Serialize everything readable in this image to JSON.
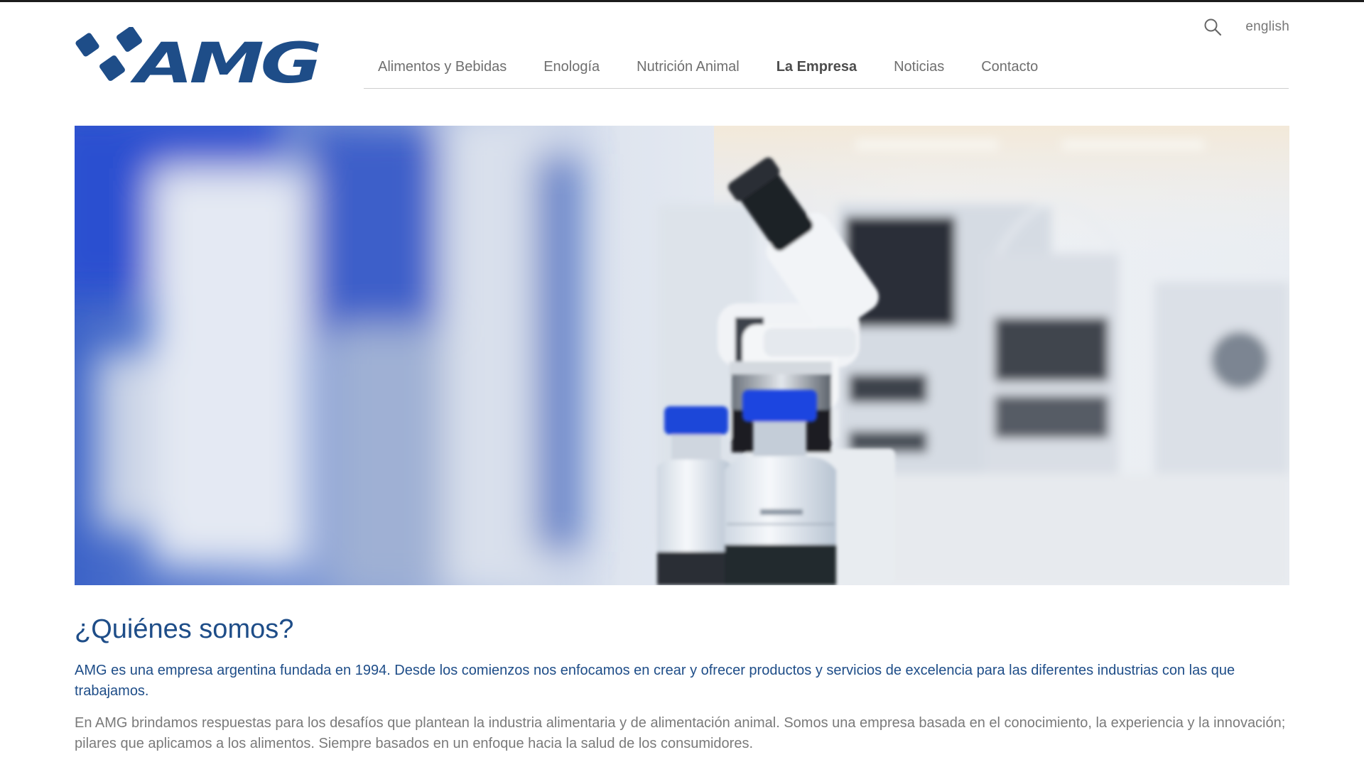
{
  "brand": {
    "name": "AMG",
    "color": "#1e4d88"
  },
  "utility": {
    "search_icon": "search-icon",
    "language_link": "english"
  },
  "nav": {
    "items": [
      {
        "label": "Alimentos y Bebidas",
        "active": false
      },
      {
        "label": "Enología",
        "active": false
      },
      {
        "label": "Nutrición Animal",
        "active": false
      },
      {
        "label": "La Empresa",
        "active": true
      },
      {
        "label": "Noticias",
        "active": false
      },
      {
        "label": "Contacto",
        "active": false
      }
    ]
  },
  "hero": {
    "image": "laboratory-microscope-photo"
  },
  "about": {
    "title": "¿Quiénes somos?",
    "lead": "AMG es una empresa argentina fundada en 1994. Desde los comienzos nos enfocamos en crear y ofrecer productos y servicios de excelencia para las diferentes industrias con las que trabajamos.",
    "body": "En AMG brindamos respuestas para los desafíos que plantean la industria alimentaria y de alimentación animal. Somos una empresa basada en el conocimiento, la experiencia y la innovación; pilares que aplicamos a los alimentos. Siempre basados en un enfoque hacia la salud de los consumidores."
  },
  "colors": {
    "accent": "#1e4d88",
    "nav_text": "#6f6f6f",
    "body_text": "#7a7a7a"
  }
}
